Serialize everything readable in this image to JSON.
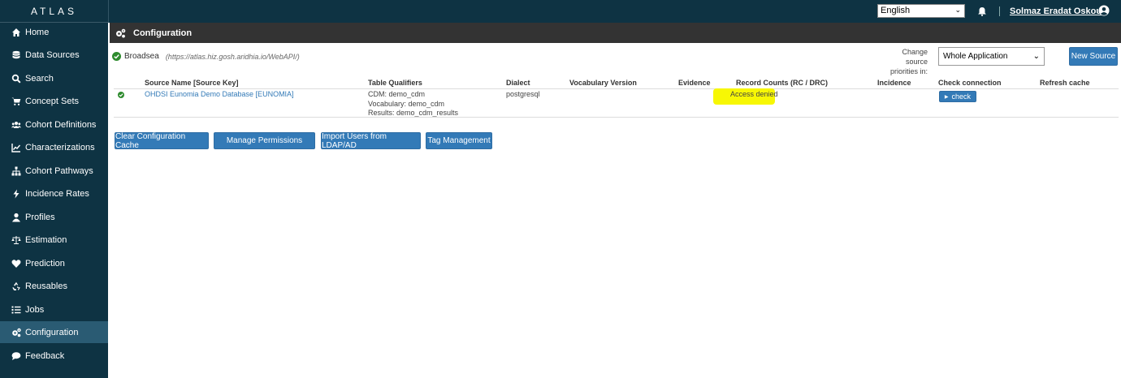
{
  "app": {
    "brand": "ATLAS"
  },
  "sidebar": {
    "items": [
      {
        "label": "Home",
        "icon": "home-icon"
      },
      {
        "label": "Data Sources",
        "icon": "database-icon"
      },
      {
        "label": "Search",
        "icon": "search-icon"
      },
      {
        "label": "Concept Sets",
        "icon": "cart-icon"
      },
      {
        "label": "Cohort Definitions",
        "icon": "users-icon"
      },
      {
        "label": "Characterizations",
        "icon": "line-chart-icon"
      },
      {
        "label": "Cohort Pathways",
        "icon": "sitemap-icon"
      },
      {
        "label": "Incidence Rates",
        "icon": "bolt-icon"
      },
      {
        "label": "Profiles",
        "icon": "user-icon"
      },
      {
        "label": "Estimation",
        "icon": "balance-scale-icon"
      },
      {
        "label": "Prediction",
        "icon": "heartbeat-icon"
      },
      {
        "label": "Reusables",
        "icon": "recycle-icon"
      },
      {
        "label": "Jobs",
        "icon": "list-icon"
      },
      {
        "label": "Configuration",
        "icon": "cogs-icon",
        "active": true
      },
      {
        "label": "Feedback",
        "icon": "comment-icon"
      }
    ]
  },
  "topbar": {
    "language": "English",
    "user_name": "Solmaz Eradat Oskoui"
  },
  "header": {
    "title": "Configuration"
  },
  "source": {
    "name": "Broadsea",
    "url": "(https://atlas.hiz.gosh.aridhia.io/WebAPI/)"
  },
  "priority": {
    "label_line1": "Change source",
    "label_line2": "priorities in:",
    "selected": "Whole Application"
  },
  "new_source_label": "New Source",
  "table": {
    "headers": [
      "Source Name [Source Key]",
      "Table Qualifiers",
      "Dialect",
      "Vocabulary Version",
      "Evidence",
      "Record Counts (RC / DRC)",
      "Incidence",
      "Check connection",
      "Refresh cache"
    ],
    "rows": [
      {
        "source_name": "OHDSI Eunomia Demo Database [EUNOMIA]",
        "qualifiers": [
          "CDM: demo_cdm",
          "Vocabulary: demo_cdm",
          "Results: demo_cdm_results"
        ],
        "dialect": "postgresql",
        "vocabulary_version": "",
        "evidence": "",
        "record_counts": "Access denied",
        "incidence": "",
        "check_label": "check",
        "refresh_cache": ""
      }
    ]
  },
  "actions": {
    "clear_cache": "Clear Configuration Cache",
    "manage_permissions": "Manage Permissions",
    "import_users": "Import Users from LDAP/AD",
    "tag_management": "Tag Management"
  },
  "colors": {
    "sidebar_bg": "#0e3343",
    "active_item": "#2a5b73",
    "header_bg": "#333333",
    "button": "#337ab7",
    "highlight": "#f7f704",
    "success": "#2e8b2e"
  }
}
